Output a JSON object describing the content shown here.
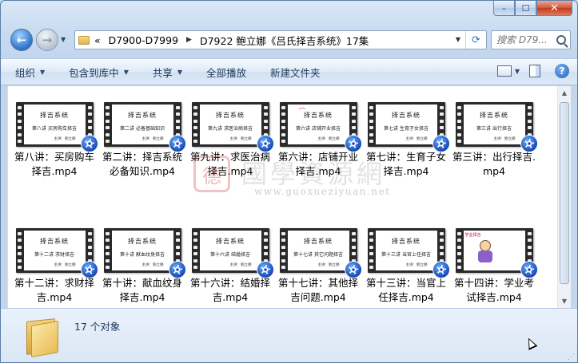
{
  "window": {
    "caption": {
      "minimize": "–",
      "maximize": "☐",
      "close": "✕"
    }
  },
  "nav": {
    "back": "←",
    "forward": "→",
    "history_dropdown": "▼"
  },
  "address": {
    "prefix": "«",
    "crumbs": [
      "D7900-D7999",
      "D7922 鲍立娜《吕氏择吉系统》17集"
    ],
    "separator": "▶",
    "dropdown": "▼",
    "refresh": "⟳"
  },
  "search": {
    "placeholder": "搜索 D79..."
  },
  "toolbar": {
    "items": [
      {
        "label": "组织",
        "has_arrow": true
      },
      {
        "label": "包含到库中",
        "has_arrow": true
      },
      {
        "label": "共享",
        "has_arrow": true
      },
      {
        "label": "全部播放",
        "has_arrow": false
      },
      {
        "label": "新建文件夹",
        "has_arrow": false
      }
    ],
    "arrow": "▼",
    "help": "?"
  },
  "files": [
    {
      "name": "第八讲：买房购车择吉.mp4",
      "thumb_title": "择吉系统",
      "thumb_sub": "第八讲 买房购车择吉"
    },
    {
      "name": "第二讲：择吉系统必备知识.mp4",
      "thumb_title": "择吉系统",
      "thumb_sub": "第二讲 必备基础知识"
    },
    {
      "name": "第九讲：求医治病择吉.mp4",
      "thumb_title": "择吉系统",
      "thumb_sub": "第九讲 求医治病择吉"
    },
    {
      "name": "第六讲：店铺开业择吉.mp4",
      "thumb_title": "择吉系统",
      "thumb_sub": "第六讲 店铺开业择吉"
    },
    {
      "name": "第七讲：生育子女择吉.mp4",
      "thumb_title": "择吉系统",
      "thumb_sub": "第七讲 生育子女择吉"
    },
    {
      "name": "第三讲：出行择吉.mp4",
      "thumb_title": "择吉系统",
      "thumb_sub": "第三讲 出行择吉"
    },
    {
      "name": "第十二讲：求财择吉.mp4",
      "thumb_title": "择吉系统",
      "thumb_sub": "第十二讲 求财择吉"
    },
    {
      "name": "第十讲：献血纹身择吉.mp4",
      "thumb_title": "择吉系统",
      "thumb_sub": "第十讲 献血纹身择吉"
    },
    {
      "name": "第十六讲：结婚择吉.mp4",
      "thumb_title": "择吉系统",
      "thumb_sub": "第十六讲 结婚择吉"
    },
    {
      "name": "第十七讲：其他择吉问题.mp4",
      "thumb_title": "择吉系统",
      "thumb_sub": "第十七讲 其它问题择吉"
    },
    {
      "name": "第十三讲：当官上任择吉.mp4",
      "thumb_title": "择吉系统",
      "thumb_sub": "第十三讲 当官上任择吉"
    },
    {
      "name": "第十四讲：学业考试择吉.mp4",
      "thumb_title": "",
      "thumb_sub": "",
      "cartoon_caption": "学业择吉"
    }
  ],
  "thumb_footer": "主讲：鲍立娜",
  "watermark": {
    "seal": "德",
    "text": "國學資源網",
    "url": "www.guoxueziyuan.net"
  },
  "status": {
    "count": "17 个对象"
  },
  "scrollbar": {
    "up": "▲",
    "down": "▼"
  }
}
